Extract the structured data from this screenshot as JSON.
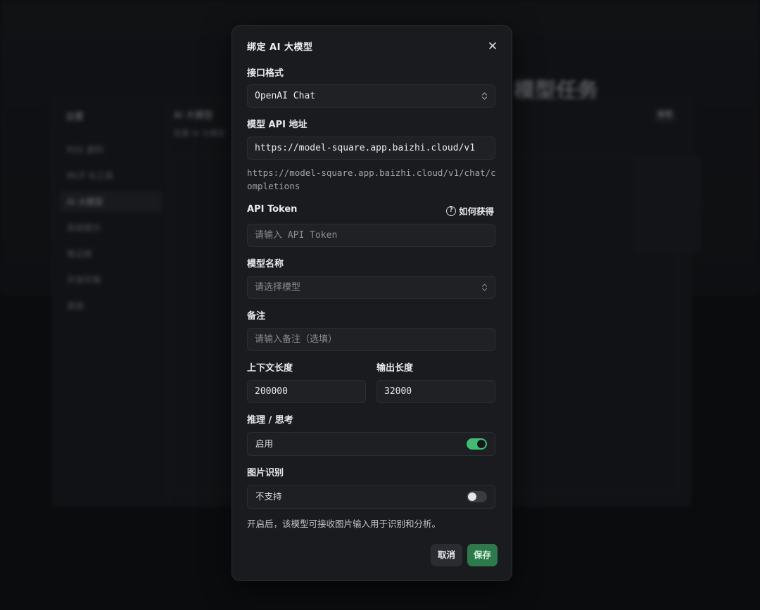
{
  "background": {
    "heading": "模型任务",
    "sidebar_title": "设置",
    "sidebar_items": [
      "RSS 源列",
      "MCP 与工具",
      "AI 大模型",
      "系统提示",
      "笔记库",
      "开发环境",
      "其他"
    ],
    "main_title": "AI 大模型",
    "main_subtitle": "配置 AI 大模型",
    "action_button": "新增"
  },
  "modal": {
    "title": "绑定 AI 大模型",
    "close_icon": "close-icon",
    "interface": {
      "label": "接口格式",
      "value": "OpenAI Chat",
      "icon": "chevron-updown-icon"
    },
    "api_url": {
      "label": "模型 API 地址",
      "value": "https://model-square.app.baizhi.cloud/v1",
      "hint": "https://model-square.app.baizhi.cloud/v1/chat/completions"
    },
    "api_token": {
      "label": "API Token",
      "help_text": "如何获得",
      "help_icon": "question-circle-icon",
      "placeholder": "请输入 API Token"
    },
    "model_name": {
      "label": "模型名称",
      "placeholder": "请选择模型",
      "icon": "chevron-updown-icon"
    },
    "remark": {
      "label": "备注",
      "placeholder": "请输入备注（选填）"
    },
    "context_length": {
      "label": "上下文长度",
      "value": "200000"
    },
    "output_length": {
      "label": "输出长度",
      "value": "32000"
    },
    "reasoning": {
      "label": "推理 / 思考",
      "status": "启用",
      "enabled": true
    },
    "image_recognition": {
      "label": "图片识别",
      "status": "不支持",
      "enabled": false,
      "note": "开启后，该模型可接收图片输入用于识别和分析。"
    },
    "buttons": {
      "cancel": "取消",
      "save": "保存"
    }
  },
  "colors": {
    "accent_green": "#3fbd73",
    "save_button": "#2c7a4b",
    "modal_bg": "#1a1b1e"
  }
}
